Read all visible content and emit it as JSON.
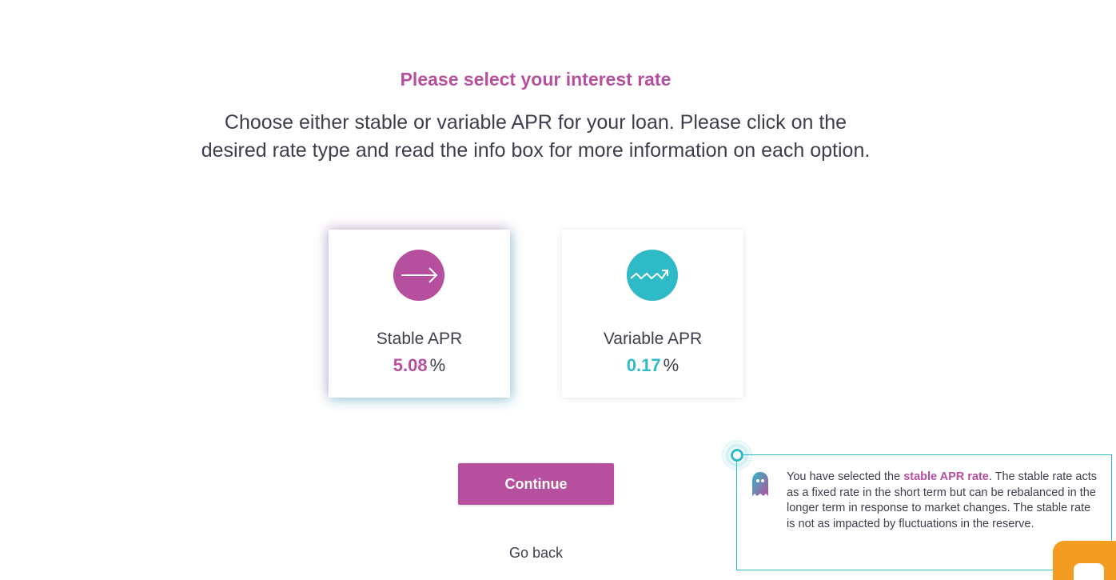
{
  "header": {
    "title": "Please select your interest rate",
    "subtitle": "Choose either stable or variable APR for your loan. Please click on the desired rate type and read the info box for more information on each option."
  },
  "options": [
    {
      "label": "Stable APR",
      "value": "5.08",
      "unit": "%",
      "icon": "arrow-right-icon",
      "color": "#b6509e",
      "selected": true
    },
    {
      "label": "Variable APR",
      "value": "0.17",
      "unit": "%",
      "icon": "trend-wave-icon",
      "color": "#2ebac6",
      "selected": false
    }
  ],
  "actions": {
    "continue_label": "Continue",
    "back_label": "Go back"
  },
  "info_box": {
    "prefix": "You have selected the ",
    "highlight": "stable APR rate",
    "suffix": ". The stable rate acts as a fixed rate in the short term but can be rebalanced in the longer term in response to market changes. The stable rate is not as impacted by fluctuations in the reserve.",
    "icon": "ghost-icon"
  },
  "colors": {
    "accent": "#b6509e",
    "secondary": "#2ebac6",
    "text": "#3d3d4e",
    "chat_widget": "#f39c21"
  },
  "chat_widget": {
    "icon": "chat-bubble-icon"
  }
}
